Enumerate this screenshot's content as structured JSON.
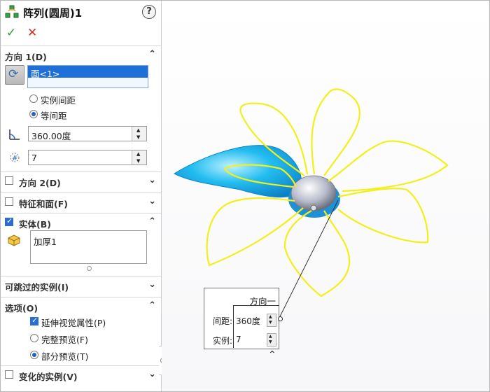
{
  "title": "阵列(圆周)1",
  "help_label": "?",
  "actions": {
    "ok_icon": "✓",
    "cancel_icon": "✕"
  },
  "direction1": {
    "header": "方向 1(D)",
    "selection": "面<1>",
    "radio_instance_spacing": "实例间距",
    "radio_equal_spacing": "等间距",
    "angle_value": "360.00度",
    "count_value": "7"
  },
  "direction2": {
    "header": "方向 2(D)",
    "checked": false
  },
  "features_faces": {
    "header": "特征和面(F)",
    "checked": false
  },
  "bodies": {
    "header": "实体(B)",
    "checked": true,
    "item": "加厚1"
  },
  "skip_instances": {
    "header": "可跳过的实例(I)"
  },
  "options": {
    "header": "选项(O)",
    "propagate_visual": "延伸视觉属性(P)",
    "full_preview": "完整预览(F)",
    "partial_preview": "部分预览(T)"
  },
  "varied_instances": {
    "header": "变化的实例(V)",
    "checked": false
  },
  "callout": {
    "header": "方向一",
    "spacing_label": "间距:",
    "spacing_value": "360度",
    "count_label": "实例:",
    "count_value": "7"
  },
  "colors": {
    "preview_outline": "#f2ef1a",
    "selected_body": "#19aee8",
    "accent": "#1f6fd9"
  }
}
